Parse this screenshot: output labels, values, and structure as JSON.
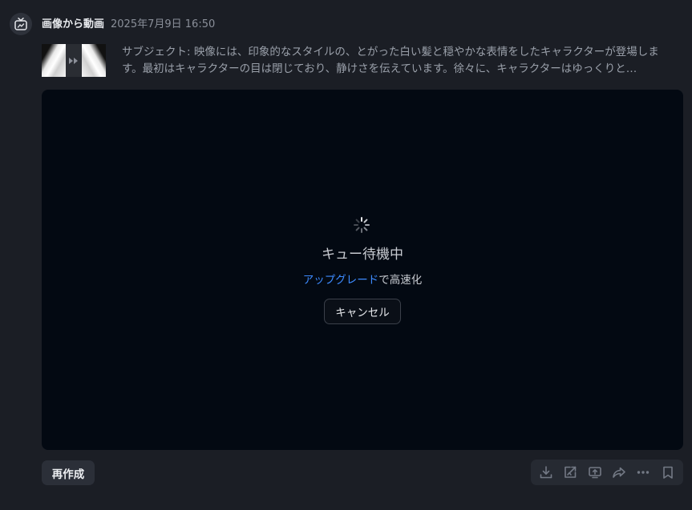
{
  "header": {
    "app_name": "画像から動画",
    "timestamp": "2025年7月9日 16:50"
  },
  "prompt": {
    "text": "サブジェクト: 映像には、印象的なスタイルの、とがった白い髪と穏やかな表情をしたキャラクターが登場します。最初はキャラクターの目は閉じており、静けさを伝えています。徐々に、キャラクターはゆっくりと…"
  },
  "status": {
    "title": "キュー待機中",
    "upgrade_link": "アップグレード",
    "upgrade_suffix": "で高速化",
    "cancel_label": "キャンセル"
  },
  "footer": {
    "recreate_label": "再作成",
    "tools": [
      "download-icon",
      "open-external-icon",
      "share-screen-icon",
      "share-icon",
      "more-icon",
      "bookmark-icon"
    ]
  },
  "colors": {
    "background": "#1b1e25",
    "panel": "#030912",
    "link": "#3d8bff"
  }
}
